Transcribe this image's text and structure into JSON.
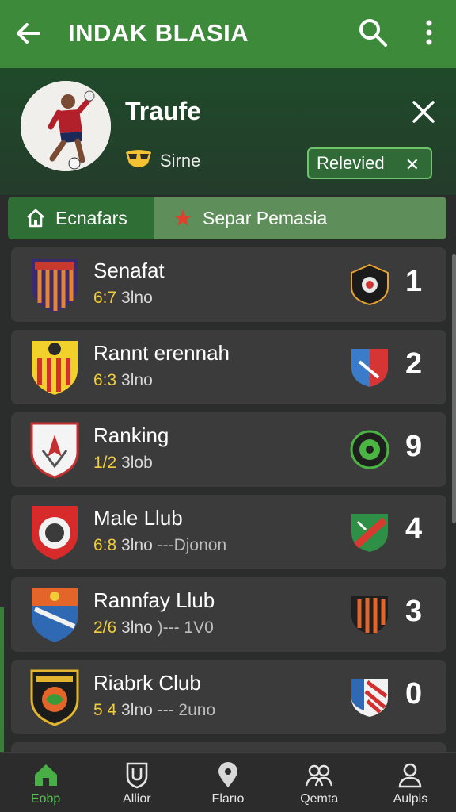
{
  "appbar": {
    "title": "INDAK BLASIA",
    "icons": [
      "back-arrow-icon",
      "search-icon",
      "more-vert-icon"
    ]
  },
  "profile": {
    "name": "Traufe",
    "badge_text": "Sirne",
    "chip_label": "Relevied",
    "chip_close": "✕",
    "colors": {
      "header": "#3d8a3a",
      "chip_border": "#6ec36b",
      "highlight": "#f2cd3b"
    }
  },
  "tabs": [
    {
      "label": "Ecnafars",
      "icon": "home-icon"
    },
    {
      "label": "Separ Pemasia",
      "icon": "star-icon"
    }
  ],
  "matches": [
    {
      "name": "Senafat",
      "meta_hi": "6:7",
      "meta": "3lno",
      "meta_extra": "",
      "score": "1",
      "crest": "crest-striped-purple",
      "opp": "crest-black-round"
    },
    {
      "name": "Rannt erennah",
      "meta_hi": "6:3",
      "meta": "3lno",
      "meta_extra": "",
      "score": "2",
      "crest": "crest-yellow-red",
      "opp": "crest-red-blue"
    },
    {
      "name": "Ranking",
      "meta_hi": "1/2",
      "meta": "3lob",
      "meta_extra": "",
      "score": "9",
      "crest": "crest-white-red",
      "opp": "crest-green-ball"
    },
    {
      "name": "Male Llub",
      "meta_hi": "6:8",
      "meta": "3lno",
      "meta_extra": "---Djonon",
      "score": "4",
      "crest": "crest-red-round",
      "opp": "crest-green-red"
    },
    {
      "name": "Rannfay Llub",
      "meta_hi": "2/6",
      "meta": "3lno",
      "meta_extra": ")--- 1V0",
      "score": "3",
      "crest": "crest-orange-blue",
      "opp": "crest-orange-black"
    },
    {
      "name": "Riabrk Club",
      "meta_hi": "5 4",
      "meta": "3lno",
      "meta_extra": "--- 2uno",
      "score": "0",
      "crest": "crest-black-gold",
      "opp": "crest-red-white-blue"
    }
  ],
  "bottom_nav": [
    {
      "label": "Eobp",
      "icon": "home-icon",
      "active": true
    },
    {
      "label": "Allior",
      "icon": "shield-icon",
      "active": false
    },
    {
      "label": "Flarıo",
      "icon": "pin-icon",
      "active": false
    },
    {
      "label": "Qemta",
      "icon": "group-icon",
      "active": false
    },
    {
      "label": "Aulpis",
      "icon": "person-icon",
      "active": false
    }
  ]
}
